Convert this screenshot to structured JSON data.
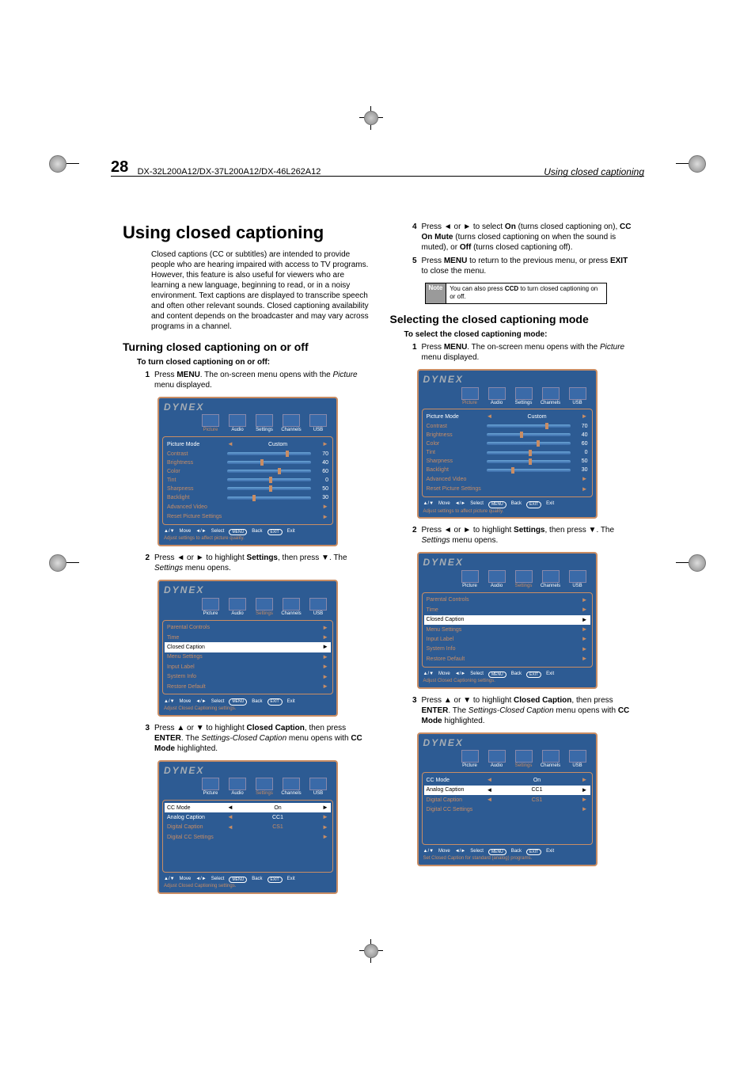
{
  "page": {
    "number": "28",
    "models": "DX-32L200A12/DX-37L200A12/DX-46L262A12",
    "section": "Using closed captioning"
  },
  "reg": {
    "mark": "⊕"
  },
  "left": {
    "h1": "Using closed captioning",
    "intro": "Closed captions (CC or subtitles) are intended to provide people who are hearing impaired with access to TV programs. However, this feature is also useful for viewers who are learning a new language, beginning to read, or in a noisy environment. Text captions are displayed to transcribe speech and often other relevant sounds. Closed captioning availability and content depends on the broadcaster and may vary across programs in a channel.",
    "h2": "Turning closed captioning on or off",
    "bold": "To turn closed captioning on or off:",
    "step1": {
      "n": "1",
      "pre": "Press ",
      "b1": "MENU",
      "post": ". The on-screen menu opens with the ",
      "ital": "Picture",
      "post2": " menu displayed."
    },
    "step2": {
      "n": "2",
      "pre": "Press ",
      "a1": "◄",
      "mid1": " or ",
      "a2": "►",
      "mid2": " to highlight ",
      "b1": "Settings",
      "mid3": ", then press ",
      "a3": "▼",
      "post": ". The ",
      "ital": "Settings",
      "post2": " menu opens."
    },
    "step3": {
      "n": "3",
      "pre": "Press ",
      "a1": "▲",
      "mid1": " or ",
      "a2": "▼",
      "mid2": " to highlight ",
      "b1": "Closed Caption",
      "mid3": ", then press ",
      "b2": "ENTER",
      "post": ". The ",
      "ital": "Settings-Closed Caption",
      "post2": " menu opens with ",
      "b3": "CC Mode",
      "post3": " highlighted."
    }
  },
  "right": {
    "step4": {
      "n": "4",
      "pre": "Press ",
      "a1": "◄",
      "mid1": " or ",
      "a2": "►",
      "mid2": " to select ",
      "b1": "On",
      "mid3": " (turns closed captioning on), ",
      "b2": "CC On Mute",
      "mid4": " (turns closed captioning on when the sound is muted), or ",
      "b3": "Off",
      "post": " (turns closed captioning off)."
    },
    "step5": {
      "n": "5",
      "pre": "Press ",
      "b1": "MENU",
      "mid1": " to return to the previous menu, or press ",
      "b2": "EXIT",
      "post": " to close the menu."
    },
    "note": {
      "hdr": "Note",
      "body_pre": "You can also press ",
      "body_b": "CCD",
      "body_post": " to turn closed captioning on or off."
    },
    "h2": "Selecting the closed captioning mode",
    "bold": "To select the closed captioning mode:",
    "step1": {
      "n": "1",
      "pre": "Press ",
      "b1": "MENU",
      "post": ". The on-screen menu opens with the ",
      "ital": "Picture",
      "post2": " menu displayed."
    },
    "step2": {
      "n": "2",
      "pre": "Press ",
      "a1": "◄",
      "mid1": " or ",
      "a2": "►",
      "mid2": " to highlight ",
      "b1": "Settings",
      "mid3": ", then press ",
      "a3": "▼",
      "post": ". The ",
      "ital": "Settings",
      "post2": " menu opens."
    },
    "step3": {
      "n": "3",
      "pre": "Press ",
      "a1": "▲",
      "mid1": " or ",
      "a2": "▼",
      "mid2": " to highlight ",
      "b1": "Closed Caption",
      "mid3": ", then press ",
      "b2": "ENTER",
      "post": ". The ",
      "ital": "Settings-Closed Caption",
      "post2": " menu opens with ",
      "b3": "CC Mode",
      "post3": " highlighted."
    }
  },
  "osd": {
    "brand": "DYNEX",
    "tabs": {
      "picture": "Picture",
      "audio": "Audio",
      "settings": "Settings",
      "channels": "Channels",
      "usb": "USB"
    },
    "foot": {
      "move": "Move",
      "select": "Select",
      "back": "Back",
      "exit": "Exit",
      "menu": "MENU",
      "exitbtn": "EXIT"
    },
    "picture": {
      "hint": "Adjust settings to affect picture quality.",
      "mode": {
        "lbl": "Picture Mode",
        "val": "Custom"
      },
      "rows": [
        {
          "lbl": "Contrast",
          "val": "70",
          "pct": 70
        },
        {
          "lbl": "Brightness",
          "val": "40",
          "pct": 40
        },
        {
          "lbl": "Color",
          "val": "60",
          "pct": 60
        },
        {
          "lbl": "Tint",
          "val": "0",
          "pct": 50
        },
        {
          "lbl": "Sharpness",
          "val": "50",
          "pct": 50
        },
        {
          "lbl": "Backlight",
          "val": "30",
          "pct": 30
        }
      ],
      "adv": "Advanced Video",
      "reset": "Reset Picture Settings"
    },
    "settings": {
      "hint": "Adjust Closed Captioning settings.",
      "rows": [
        {
          "lbl": "Parental Controls"
        },
        {
          "lbl": "Time"
        },
        {
          "lbl": "Closed Caption",
          "hl": true
        },
        {
          "lbl": "Menu Settings"
        },
        {
          "lbl": "Input Label"
        },
        {
          "lbl": "System Info"
        },
        {
          "lbl": "Restore Default"
        }
      ]
    },
    "cc": {
      "hint": "Adjust Closed Captioning settings.",
      "hint2": "Set Closed Caption for standard (analog) programs.",
      "rows": [
        {
          "lbl": "CC Mode",
          "val": "On",
          "hl": true
        },
        {
          "lbl": "Analog Caption",
          "val": "CC1",
          "hl2": true
        },
        {
          "lbl": "Digital Caption",
          "val": "CS1"
        },
        {
          "lbl": "Digital CC Settings"
        }
      ]
    }
  },
  "chart_data": {
    "type": "table",
    "title": "Picture menu slider values",
    "categories": [
      "Contrast",
      "Brightness",
      "Color",
      "Tint",
      "Sharpness",
      "Backlight"
    ],
    "values": [
      70,
      40,
      60,
      0,
      50,
      30
    ]
  }
}
